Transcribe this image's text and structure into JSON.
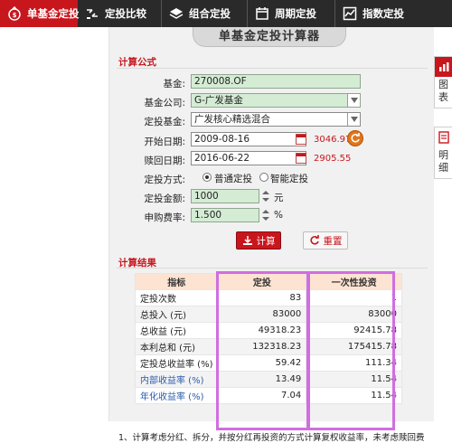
{
  "nav": {
    "items": [
      {
        "label": "单基金定投",
        "icon": "money-bag-icon"
      },
      {
        "label": "定投比较",
        "icon": "compare-icon"
      },
      {
        "label": "组合定投",
        "icon": "layers-icon"
      },
      {
        "label": "周期定投",
        "icon": "calendar-icon"
      },
      {
        "label": "指数定投",
        "icon": "chart-icon"
      }
    ]
  },
  "calculator": {
    "title": "单基金定投计算器",
    "formula_section": "计算公式",
    "results_section": "计算结果"
  },
  "form": {
    "fund_label": "基金:",
    "fund_value": "270008.OF",
    "company_label": "基金公司:",
    "company_value": "G-广发基金",
    "invest_fund_label": "定投基金:",
    "invest_fund_value": "广发核心精选混合",
    "start_label": "开始日期:",
    "start_value": "2009-08-16",
    "start_nav": "3046.97",
    "redeem_label": "赎回日期:",
    "redeem_value": "2016-06-22",
    "redeem_nav": "2905.55",
    "method_label": "定投方式:",
    "method_options": [
      "普通定投",
      "智能定投"
    ],
    "method_selected": "普通定投",
    "amount_label": "定投金额:",
    "amount_value": "1000",
    "amount_unit": "元",
    "fee_label": "申购费率:",
    "fee_value": "1.500",
    "fee_unit": "%",
    "calc_button": "计算",
    "reset_button": "重置"
  },
  "results": {
    "headers": [
      "指标",
      "定投",
      "一次性投资"
    ],
    "rows": [
      {
        "label": "定投次数",
        "dingtou": "83",
        "lump": "1"
      },
      {
        "label": "总投入 (元)",
        "dingtou": "83000",
        "lump": "83000"
      },
      {
        "label": "总收益 (元)",
        "dingtou": "49318.23",
        "lump": "92415.78"
      },
      {
        "label": "本利总和 (元)",
        "dingtou": "132318.23",
        "lump": "175415.78"
      },
      {
        "label": "定投总收益率 (%)",
        "dingtou": "59.42",
        "lump": "111.34"
      },
      {
        "label": "内部收益率 (%)",
        "dingtou": "13.49",
        "lump": "11.54"
      },
      {
        "label": "年化收益率 (%)",
        "dingtou": "7.04",
        "lump": "11.54"
      }
    ],
    "footnote": "1、计算考虑分红、拆分，并按分红再投资的方式计算复权收益率，未考虑赎回费"
  },
  "side_tabs": [
    {
      "label": "图表",
      "icon": "bar-chart-icon"
    },
    {
      "label": "明细",
      "icon": "document-icon"
    }
  ],
  "colors": {
    "accent": "#c8161d",
    "nav_bg": "#2a2a2a",
    "field_bg": "#d4ecd4",
    "header_bg": "#fde3d2",
    "highlight": "#d06ee0",
    "link_blue": "#2a5cab"
  }
}
